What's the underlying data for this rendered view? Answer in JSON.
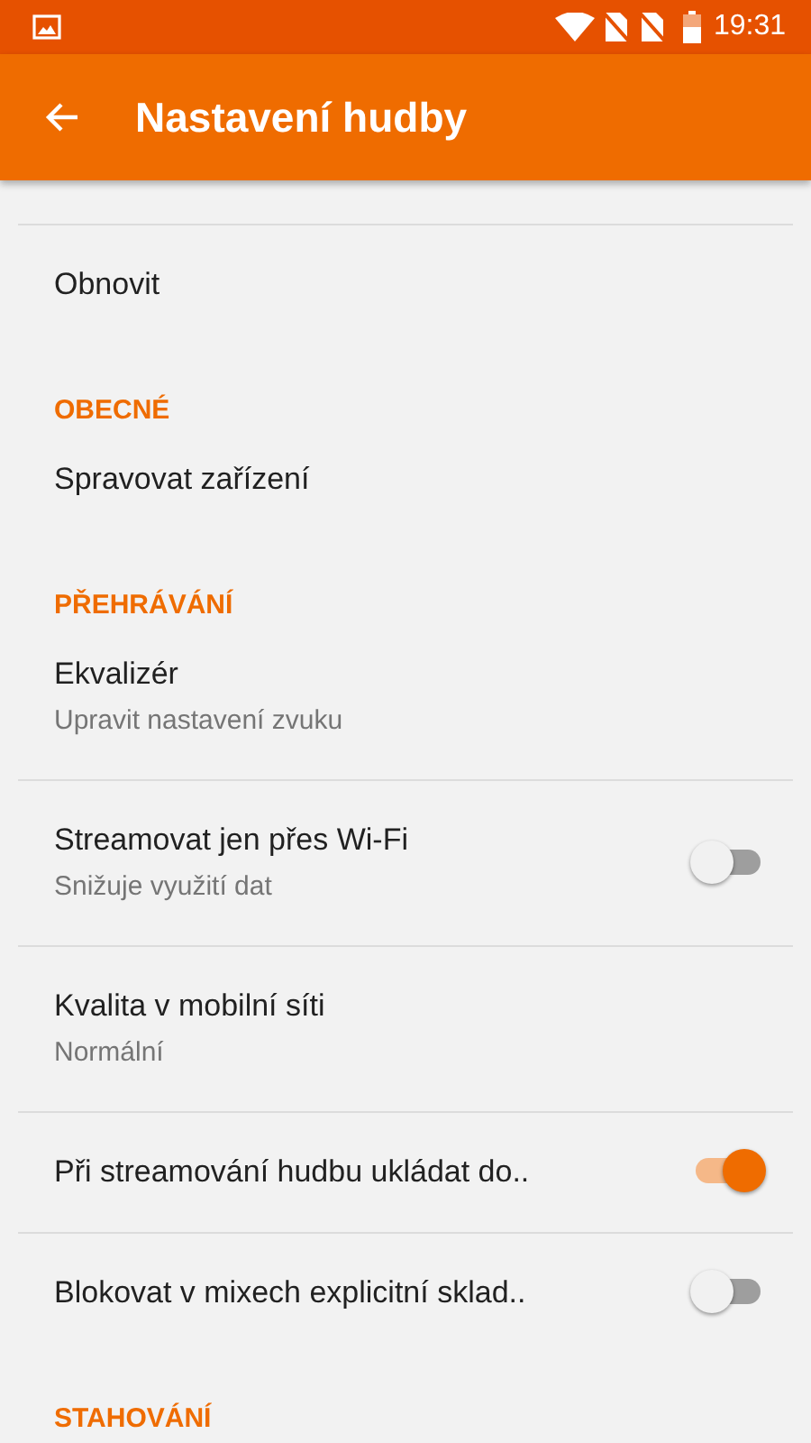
{
  "status_bar": {
    "time": "19:31"
  },
  "app_bar": {
    "title": "Nastavení hudby"
  },
  "items": [
    {
      "kind": "divider"
    },
    {
      "kind": "item",
      "title": "Obnovit",
      "divider": false
    },
    {
      "kind": "header",
      "title": "OBECNÉ"
    },
    {
      "kind": "item",
      "title": "Spravovat zařízení",
      "divider": false
    },
    {
      "kind": "header",
      "title": "PŘEHRÁVÁNÍ"
    },
    {
      "kind": "item",
      "title": "Ekvalizér",
      "subtitle": "Upravit nastavení zvuku",
      "divider": true
    },
    {
      "kind": "switch",
      "title": "Streamovat jen přes Wi-Fi",
      "subtitle": "Snižuje využití dat",
      "on": false,
      "divider": true
    },
    {
      "kind": "item",
      "title": "Kvalita v mobilní síti",
      "subtitle": "Normální",
      "divider": true
    },
    {
      "kind": "switch",
      "title": "Při streamování hudbu ukládat do..",
      "on": true,
      "divider": true
    },
    {
      "kind": "switch",
      "title": "Blokovat v mixech explicitní sklad..",
      "on": false,
      "divider": false
    },
    {
      "kind": "header",
      "title": "STAHOVÁNÍ"
    }
  ]
}
